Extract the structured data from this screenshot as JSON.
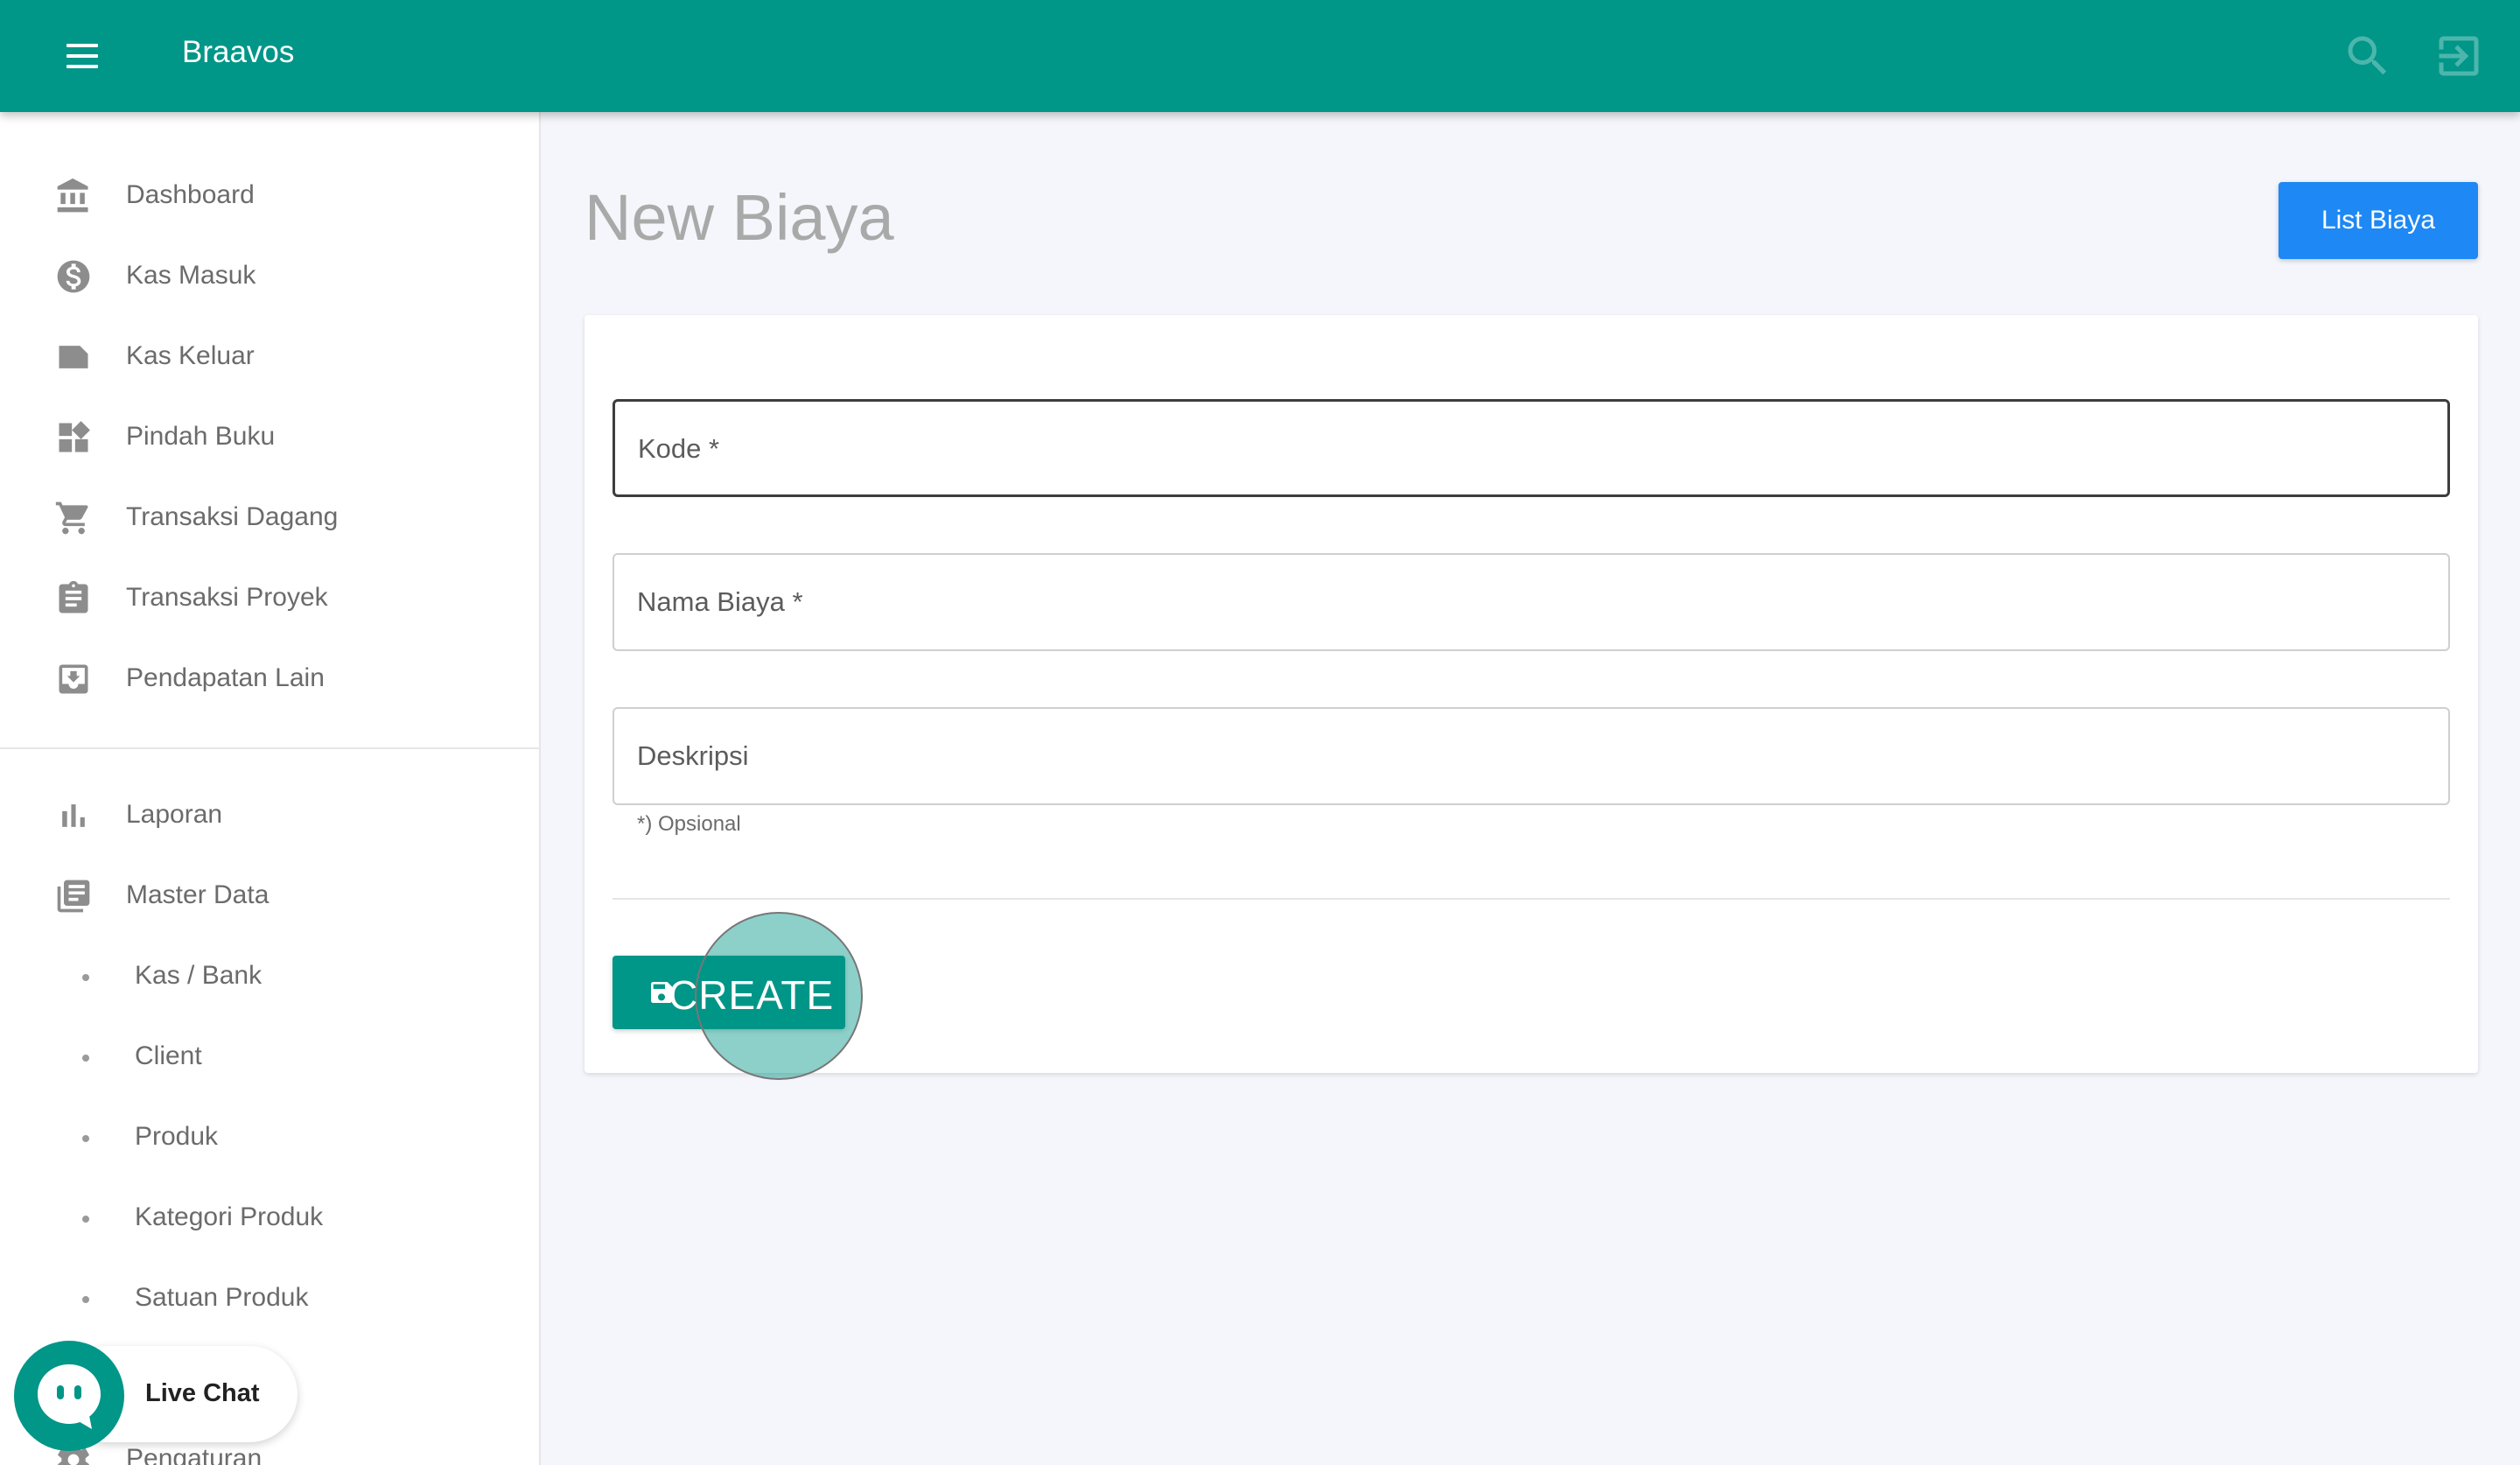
{
  "app": {
    "title": "Braavos"
  },
  "header": {
    "search_icon": "search-icon",
    "logout_icon": "exit-icon"
  },
  "sidebar": {
    "items": [
      {
        "label": "Dashboard",
        "icon": "bank-icon"
      },
      {
        "label": "Kas Masuk",
        "icon": "dollar-circle-icon"
      },
      {
        "label": "Kas Keluar",
        "icon": "label-icon"
      },
      {
        "label": "Pindah Buku",
        "icon": "widgets-icon"
      },
      {
        "label": "Transaksi Dagang",
        "icon": "cart-icon"
      },
      {
        "label": "Transaksi Proyek",
        "icon": "clipboard-icon"
      },
      {
        "label": "Pendapatan Lain",
        "icon": "inbox-icon"
      }
    ],
    "reports": [
      {
        "label": "Laporan",
        "icon": "bar-chart-icon"
      },
      {
        "label": "Master Data",
        "icon": "library-books-icon"
      }
    ],
    "master_sub": [
      "Kas / Bank",
      "Client",
      "Produk",
      "Kategori Produk",
      "Satuan Produk"
    ],
    "settings": {
      "label": "Pengaturan",
      "icon": "settings-icon"
    }
  },
  "page": {
    "title": "New Biaya",
    "list_button": "List Biaya"
  },
  "form": {
    "kode_label": "Kode *",
    "nama_label": "Nama Biaya *",
    "deskripsi_label": "Deskripsi",
    "hint": "*) Opsional",
    "create_button": "CREATE"
  },
  "chat": {
    "label": "Live Chat"
  },
  "colors": {
    "primary": "#009688",
    "accent_blue": "#1e88f4"
  }
}
